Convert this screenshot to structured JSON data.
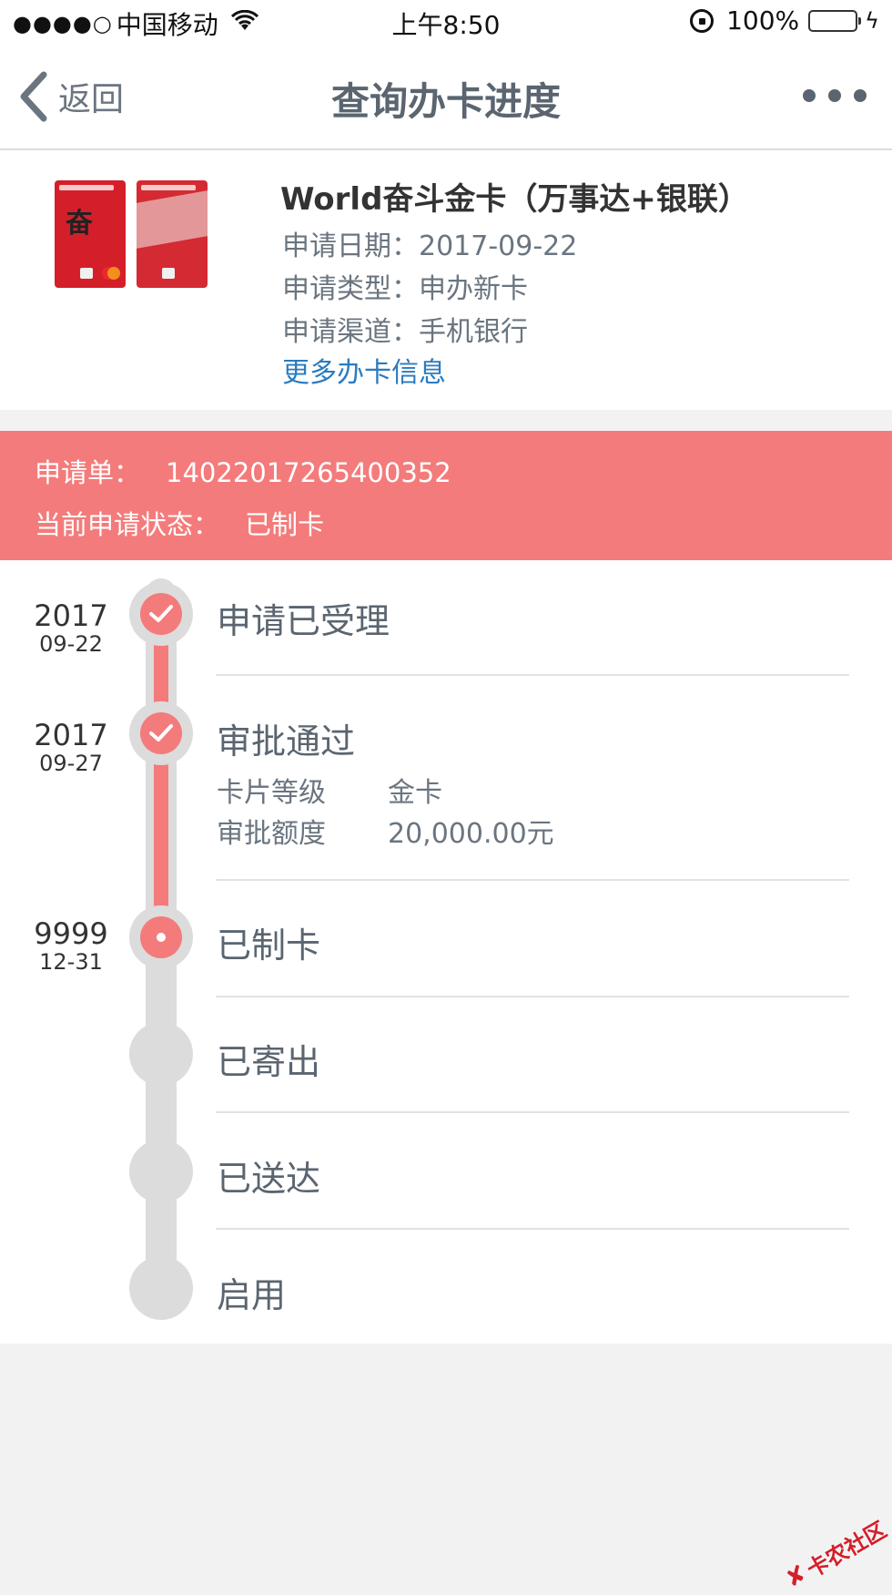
{
  "status_bar": {
    "signal_dots": "●●●●○",
    "carrier": "中国移动",
    "time": "上午8:50",
    "battery_text": "100%",
    "battery_level": 1.0,
    "icons": [
      "wifi-icon",
      "orientation-lock-icon",
      "battery-icon",
      "charging-bolt-icon"
    ]
  },
  "nav": {
    "back_label": "返回",
    "title": "查询办卡进度",
    "icons": [
      "chevron-left-icon",
      "more-dots-icon"
    ]
  },
  "card": {
    "name": "World奋斗金卡（万事达+银联）",
    "apply_date_label": "申请日期：",
    "apply_date": "2017-09-22",
    "apply_type_label": "申请类型：",
    "apply_type": "申办新卡",
    "apply_channel_label": "申请渠道：",
    "apply_channel": "手机银行",
    "more_info_link": "更多办卡信息"
  },
  "application": {
    "number_label": "申请单：",
    "number": "14022017265400352",
    "status_label": "当前申请状态：",
    "status": "已制卡"
  },
  "timeline": {
    "steps": [
      {
        "title": "申请已受理",
        "year": "2017",
        "date": "09-22",
        "state": "done"
      },
      {
        "title": "审批通过",
        "year": "2017",
        "date": "09-27",
        "state": "done",
        "details": [
          {
            "label": "卡片等级",
            "value": "金卡"
          },
          {
            "label": "审批额度",
            "value": "20,000.00元"
          }
        ]
      },
      {
        "title": "已制卡",
        "year": "9999",
        "date": "12-31",
        "state": "current"
      },
      {
        "title": "已寄出",
        "state": "pending"
      },
      {
        "title": "已送达",
        "state": "pending"
      },
      {
        "title": "启用",
        "state": "pending"
      }
    ]
  },
  "watermark": {
    "text": "卡农社区"
  },
  "colors": {
    "accent_red": "#f47b7b",
    "link_blue": "#2a7bbf",
    "battery_green": "#4cd964"
  }
}
